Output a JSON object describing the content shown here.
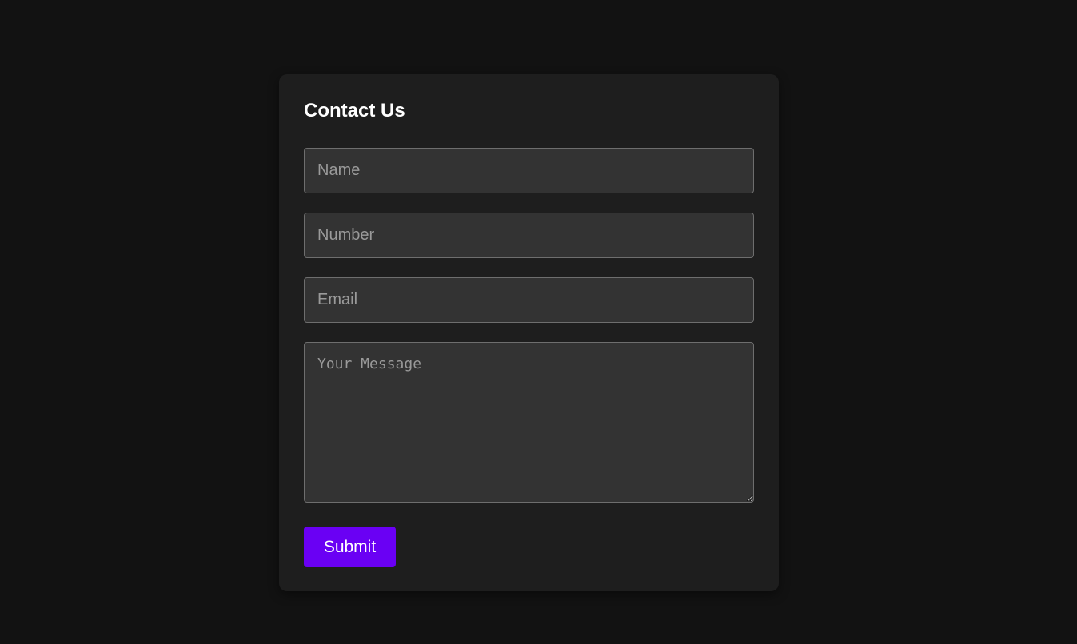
{
  "form": {
    "title": "Contact Us",
    "name_placeholder": "Name",
    "name_value": "",
    "number_placeholder": "Number",
    "number_value": "",
    "email_placeholder": "Email",
    "email_value": "",
    "message_placeholder": "Your Message",
    "message_value": "",
    "submit_label": "Submit"
  },
  "colors": {
    "page_background": "#121212",
    "card_background": "#1e1e1e",
    "field_background": "#333333",
    "field_border": "#6e6e6e",
    "accent": "#6a00f4",
    "title_text": "#ffffff"
  }
}
